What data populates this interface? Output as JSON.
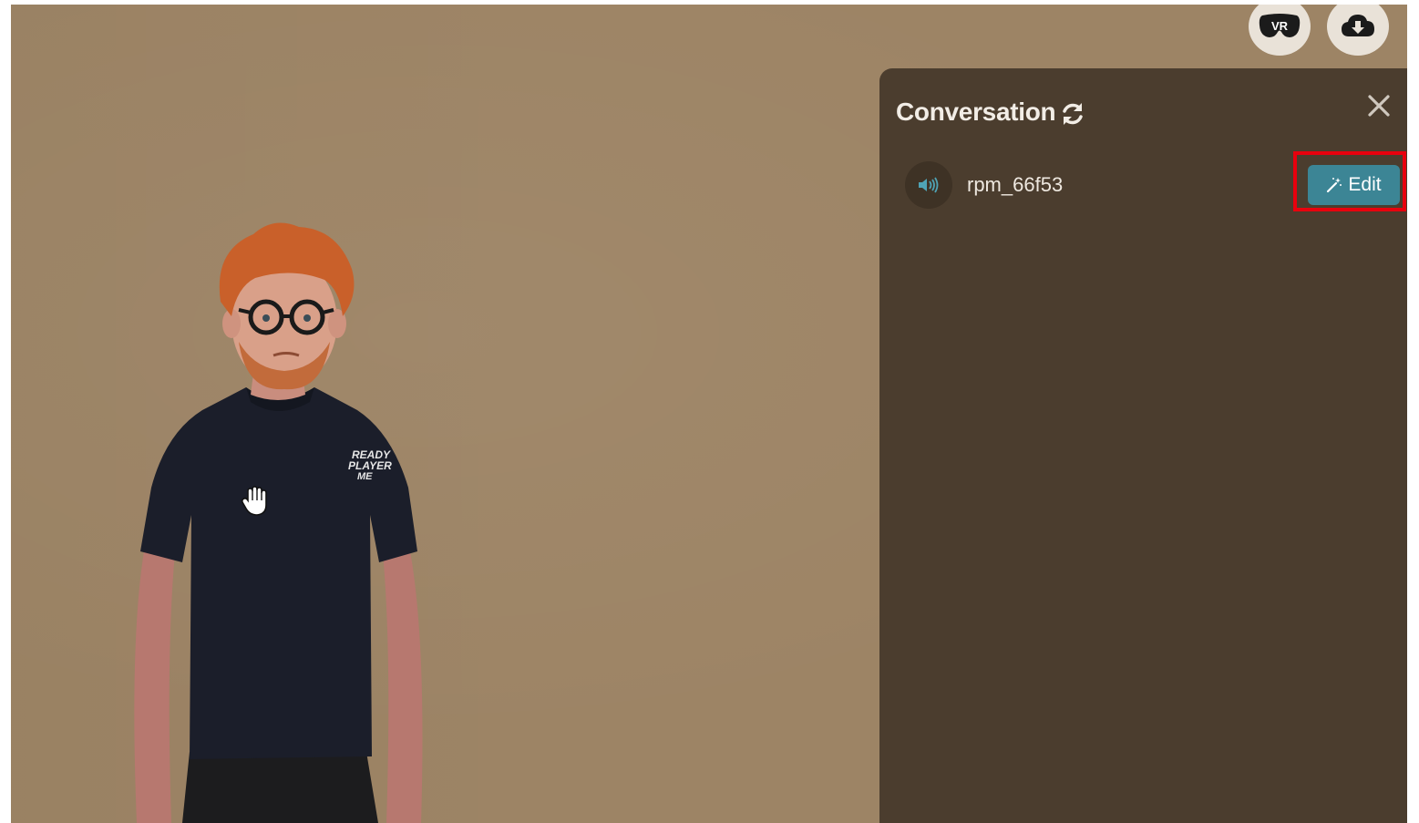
{
  "toolbar": {
    "vr_label": "VR",
    "vr_icon": "vr-headset-icon",
    "download_icon": "cloud-download-icon"
  },
  "panel": {
    "title": "Conversation",
    "refresh_icon": "refresh-icon",
    "close_icon": "close-icon",
    "conversations": [
      {
        "name": "rpm_66f53",
        "speaker_icon": "speaker-icon",
        "edit_label": "Edit",
        "edit_icon": "magic-wand-icon"
      }
    ]
  },
  "avatar": {
    "shirt_text": "READY PLAYER ME"
  },
  "colors": {
    "scene_background": "#9d8465",
    "panel_background": "#4b3d2e",
    "edit_button": "#3c8595",
    "highlight": "#e8000d"
  }
}
